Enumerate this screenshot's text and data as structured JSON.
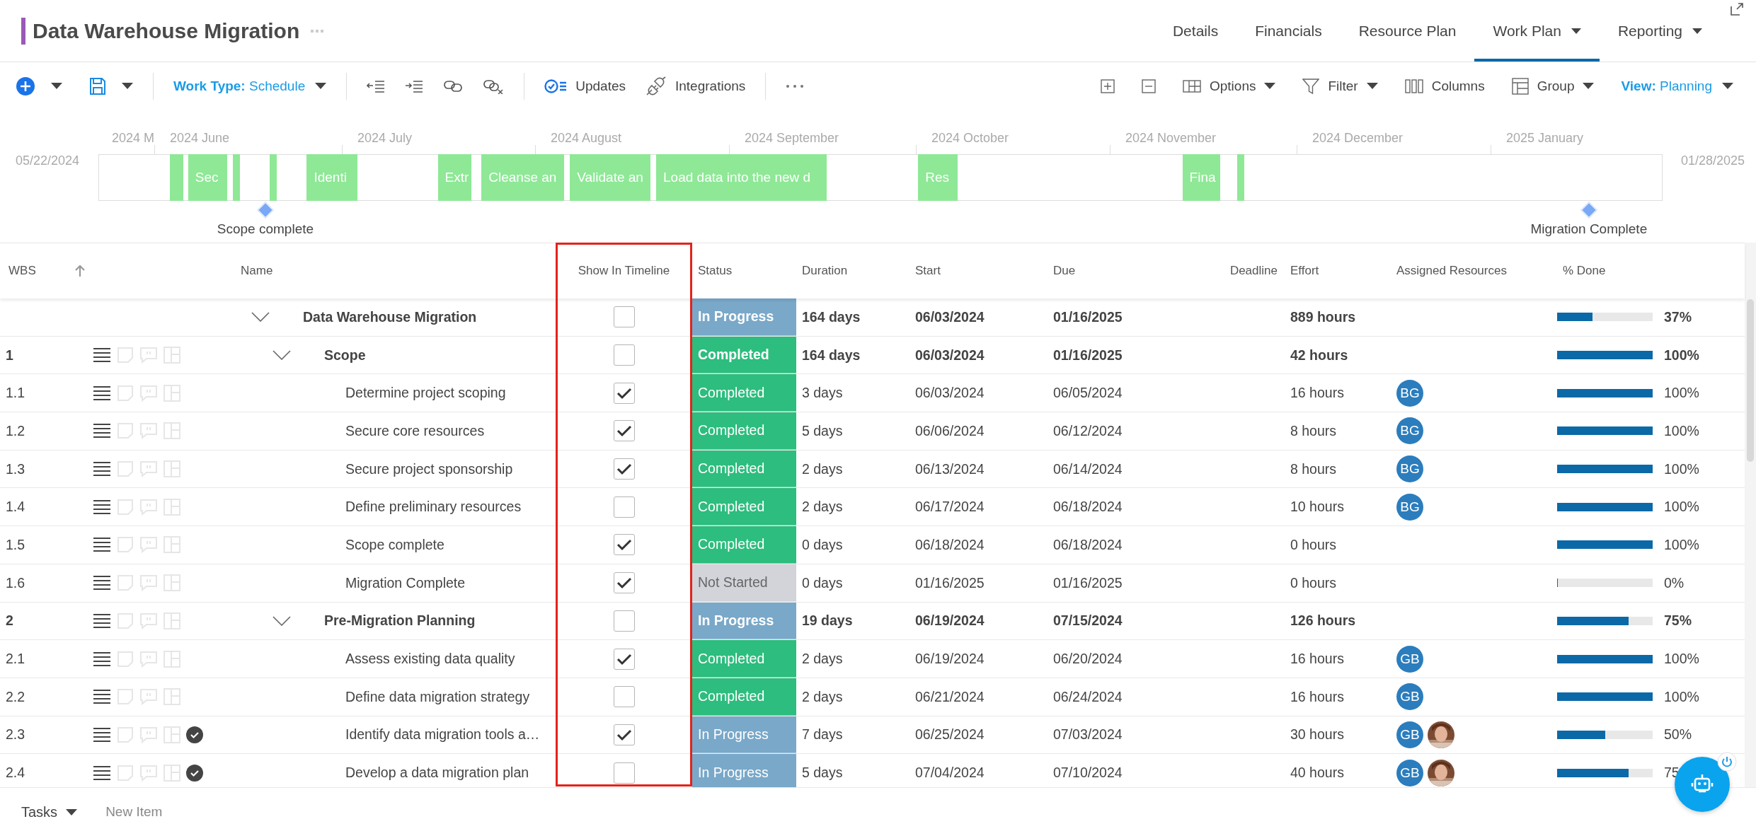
{
  "header": {
    "title": "Data Warehouse Migration"
  },
  "tabs": [
    {
      "label": "Details",
      "selected": false,
      "has_menu": false
    },
    {
      "label": "Financials",
      "selected": false,
      "has_menu": false
    },
    {
      "label": "Resource Plan",
      "selected": false,
      "has_menu": false
    },
    {
      "label": "Work Plan",
      "selected": true,
      "has_menu": true
    },
    {
      "label": "Reporting",
      "selected": false,
      "has_menu": true
    }
  ],
  "toolbar": {
    "work_type_label": "Work Type:",
    "work_type_value": "Schedule",
    "updates": "Updates",
    "integrations": "Integrations",
    "options": "Options",
    "filter": "Filter",
    "columns": "Columns",
    "group": "Group",
    "view_label": "View:",
    "view_value": "Planning"
  },
  "timeline": {
    "start": "05/22/2024",
    "end": "01/28/2025",
    "months": [
      "2024 M",
      "2024 June",
      "2024 July",
      "2024 August",
      "2024 September",
      "2024 October",
      "2024 November",
      "2024 December",
      "2025 January"
    ],
    "items": [
      {
        "kind": "bar"
      },
      {
        "kind": "bar",
        "label": "Sec"
      },
      {
        "kind": "bar"
      },
      {
        "kind": "bar"
      },
      {
        "kind": "bar",
        "label": "Identi"
      },
      {
        "kind": "bar",
        "label": "Extr"
      },
      {
        "kind": "bar",
        "label": "Cleanse an"
      },
      {
        "kind": "bar",
        "label": "Validate an"
      },
      {
        "kind": "bar",
        "label": "Load data into the new d"
      },
      {
        "kind": "bar",
        "label": "Res"
      },
      {
        "kind": "bar",
        "label": "Fina"
      },
      {
        "kind": "bar"
      },
      {
        "kind": "milestone",
        "label": "Scope complete"
      },
      {
        "kind": "milestone",
        "label": "Migration Complete"
      }
    ]
  },
  "table": {
    "columns": [
      "WBS",
      "Name",
      "Show In Timeline",
      "Status",
      "Duration",
      "Start",
      "Due",
      "Deadline",
      "Effort",
      "Assigned Resources",
      "% Done"
    ],
    "rows": [
      {
        "name": "Data Warehouse Migration",
        "expanded": true,
        "show_in_timeline": false,
        "check_mark": false,
        "status": {
          "label": "In Progress",
          "color": "#79a8c9"
        },
        "duration": "164 days",
        "start": "06/03/2024",
        "due": "01/16/2025",
        "effort": "889 hours",
        "level": 0.37,
        "done": "37%",
        "children": [
          {
            "wbs": "1",
            "name": "Scope",
            "expanded": true,
            "show_in_timeline": false,
            "check_mark": false,
            "status": {
              "label": "Completed",
              "color": "#2dbd7e"
            },
            "duration": "164 days",
            "start": "06/03/2024",
            "due": "01/16/2025",
            "effort": "42 hours",
            "level": 1,
            "done": "100%",
            "children": [
              {
                "wbs": "1.1",
                "name": "Determine project scoping",
                "show_in_timeline": true,
                "check_mark": false,
                "status": {
                  "label": "Completed",
                  "color": "#2dbd7e"
                },
                "duration": "3 days",
                "start": "06/03/2024",
                "due": "06/05/2024",
                "effort": "16 hours",
                "resources": [
                  {
                    "kind": "initials",
                    "initials": "BG"
                  }
                ],
                "level": 1,
                "done": "100%"
              },
              {
                "wbs": "1.2",
                "name": "Secure core resources",
                "show_in_timeline": true,
                "check_mark": false,
                "status": {
                  "label": "Completed",
                  "color": "#2dbd7e"
                },
                "duration": "5 days",
                "start": "06/06/2024",
                "due": "06/12/2024",
                "effort": "8 hours",
                "resources": [
                  {
                    "kind": "initials",
                    "initials": "BG"
                  }
                ],
                "level": 1,
                "done": "100%"
              },
              {
                "wbs": "1.3",
                "name": "Secure project sponsorship",
                "show_in_timeline": true,
                "check_mark": false,
                "status": {
                  "label": "Completed",
                  "color": "#2dbd7e"
                },
                "duration": "2 days",
                "start": "06/13/2024",
                "due": "06/14/2024",
                "effort": "8 hours",
                "resources": [
                  {
                    "kind": "initials",
                    "initials": "BG"
                  }
                ],
                "level": 1,
                "done": "100%"
              },
              {
                "wbs": "1.4",
                "name": "Define preliminary resources",
                "show_in_timeline": false,
                "check_mark": false,
                "status": {
                  "label": "Completed",
                  "color": "#2dbd7e"
                },
                "duration": "2 days",
                "start": "06/17/2024",
                "due": "06/18/2024",
                "effort": "10 hours",
                "resources": [
                  {
                    "kind": "initials",
                    "initials": "BG"
                  }
                ],
                "level": 1,
                "done": "100%"
              },
              {
                "wbs": "1.5",
                "name": "Scope complete",
                "show_in_timeline": true,
                "check_mark": false,
                "status": {
                  "label": "Completed",
                  "color": "#2dbd7e"
                },
                "duration": "0 days",
                "start": "06/18/2024",
                "due": "06/18/2024",
                "effort": "0 hours",
                "level": 1,
                "done": "100%"
              },
              {
                "wbs": "1.6",
                "name": "Migration Complete",
                "show_in_timeline": true,
                "check_mark": false,
                "status": {
                  "label": "Not Started",
                  "color": "#d2d4d9"
                },
                "duration": "0 days",
                "start": "01/16/2025",
                "due": "01/16/2025",
                "effort": "0 hours",
                "level": 0,
                "done": "0%"
              }
            ]
          },
          {
            "wbs": "2",
            "name": "Pre-Migration Planning",
            "expanded": true,
            "show_in_timeline": false,
            "check_mark": false,
            "status": {
              "label": "In Progress",
              "color": "#79a8c9"
            },
            "duration": "19 days",
            "start": "06/19/2024",
            "due": "07/15/2024",
            "effort": "126 hours",
            "level": 0.75,
            "done": "75%",
            "children": [
              {
                "wbs": "2.1",
                "name": "Assess existing data quality",
                "show_in_timeline": true,
                "check_mark": false,
                "status": {
                  "label": "Completed",
                  "color": "#2dbd7e"
                },
                "duration": "2 days",
                "start": "06/19/2024",
                "due": "06/20/2024",
                "effort": "16 hours",
                "resources": [
                  {
                    "kind": "initials",
                    "initials": "GB"
                  }
                ],
                "level": 1,
                "done": "100%"
              },
              {
                "wbs": "2.2",
                "name": "Define data migration strategy",
                "show_in_timeline": false,
                "check_mark": false,
                "status": {
                  "label": "Completed",
                  "color": "#2dbd7e"
                },
                "duration": "2 days",
                "start": "06/21/2024",
                "due": "06/24/2024",
                "effort": "16 hours",
                "resources": [
                  {
                    "kind": "initials",
                    "initials": "GB"
                  }
                ],
                "level": 1,
                "done": "100%"
              },
              {
                "wbs": "2.3",
                "name": "Identify data migration tools a…",
                "show_in_timeline": true,
                "check_mark": true,
                "status": {
                  "label": "In Progress",
                  "color": "#79a8c9"
                },
                "duration": "7 days",
                "start": "06/25/2024",
                "due": "07/03/2024",
                "effort": "30 hours",
                "resources": [
                  {
                    "kind": "initials",
                    "initials": "GB"
                  },
                  {
                    "kind": "picture"
                  }
                ],
                "level": 0.5,
                "done": "50%"
              },
              {
                "wbs": "2.4",
                "name": "Develop a data migration plan",
                "show_in_timeline": false,
                "check_mark": true,
                "status": {
                  "label": "In Progress",
                  "color": "#79a8c9"
                },
                "duration": "5 days",
                "start": "07/04/2024",
                "due": "07/10/2024",
                "effort": "40 hours",
                "resources": [
                  {
                    "kind": "initials",
                    "initials": "GB"
                  },
                  {
                    "kind": "picture"
                  }
                ],
                "level": 0.75,
                "done": "75"
              }
            ]
          }
        ]
      }
    ]
  },
  "footer": {
    "view": "Tasks",
    "new_item": "New Item"
  }
}
